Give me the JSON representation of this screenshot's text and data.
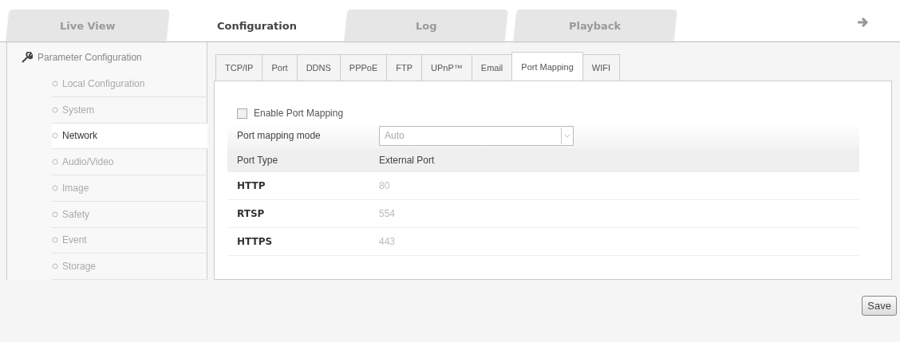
{
  "main_tabs": [
    {
      "label": "Live View",
      "selected": false
    },
    {
      "label": "Configuration",
      "selected": true
    },
    {
      "label": "Log",
      "selected": false
    },
    {
      "label": "Playback",
      "selected": false
    }
  ],
  "sidebar": {
    "title": "Parameter Configuration",
    "items": [
      {
        "label": "Local Configuration",
        "selected": false
      },
      {
        "label": "System",
        "selected": false
      },
      {
        "label": "Network",
        "selected": true
      },
      {
        "label": "Audio/Video",
        "selected": false
      },
      {
        "label": "Image",
        "selected": false
      },
      {
        "label": "Safety",
        "selected": false
      },
      {
        "label": "Event",
        "selected": false
      },
      {
        "label": "Storage",
        "selected": false
      }
    ]
  },
  "sub_tabs": [
    {
      "label": "TCP/IP",
      "selected": false
    },
    {
      "label": "Port",
      "selected": false
    },
    {
      "label": "DDNS",
      "selected": false
    },
    {
      "label": "PPPoE",
      "selected": false
    },
    {
      "label": "FTP",
      "selected": false
    },
    {
      "label": "UPnP™",
      "selected": false
    },
    {
      "label": "Email",
      "selected": false
    },
    {
      "label": "Port Mapping",
      "selected": true
    },
    {
      "label": "WIFI",
      "selected": false
    }
  ],
  "enable_port_mapping": {
    "label": "Enable Port Mapping",
    "checked": false
  },
  "mode": {
    "label": "Port mapping mode",
    "value": "Auto"
  },
  "table": {
    "columns": [
      "Port Type",
      "External Port"
    ],
    "rows": [
      {
        "type": "HTTP",
        "port": "80"
      },
      {
        "type": "RTSP",
        "port": "554"
      },
      {
        "type": "HTTPS",
        "port": "443"
      }
    ]
  },
  "save_button": "Save"
}
